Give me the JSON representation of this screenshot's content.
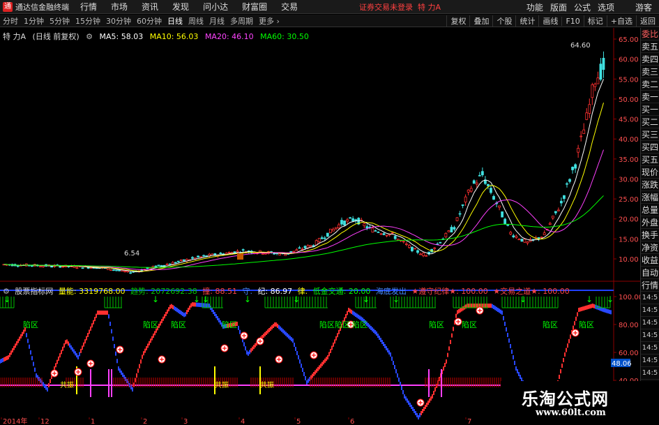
{
  "app": {
    "title": "通达信金融终端",
    "menus": [
      "行情",
      "市场",
      "资讯",
      "发现",
      "问小达",
      "财富圈",
      "交易"
    ],
    "notice": "证券交易未登录",
    "stock_name": "特 力A",
    "right_menus": [
      "功能",
      "版面",
      "公式",
      "选项"
    ],
    "guest": "游客"
  },
  "periods": {
    "items": [
      "分时",
      "1分钟",
      "5分钟",
      "15分钟",
      "30分钟",
      "60分钟",
      "日线",
      "周线",
      "月线",
      "多周期",
      "更多"
    ],
    "active_index": 6
  },
  "tools": [
    "复权",
    "叠加",
    "个股",
    "统计",
    "画线",
    "F10",
    "标记",
    "+自选",
    "返回"
  ],
  "main_legend": {
    "stock": "特 力A",
    "mode": "(日线 前复权)",
    "ma5": "MA5: 58.03",
    "ma10": "MA10: 56.03",
    "ma20": "MA20: 46.10",
    "ma60": "MA60: 30.50",
    "high_label": "64.60",
    "low_label": "6.54",
    "colors": {
      "ma5": "#ffffff",
      "ma10": "#ffff00",
      "ma20": "#ff40ff",
      "ma60": "#00ff00"
    }
  },
  "price_axis": [
    "65.00",
    "60.00",
    "55.00",
    "50.00",
    "45.00",
    "40.00",
    "35.00",
    "30.00",
    "25.00",
    "20.00",
    "15.00",
    "10.00"
  ],
  "indicator_legend": {
    "name": "股票指标网",
    "volume": "量能: 3319768.00",
    "trend": "趋势: 2072692.38",
    "p1": "撞: 88.51",
    "p2": "守.",
    "p3": "纪: 86.97",
    "p4": "律.",
    "p5": "低金交通: 20.00",
    "p6": "海底发出",
    "p7": "★遵守纪律★: 100.00",
    "p8": "★交易之道★: 100.00"
  },
  "indicator_axis": [
    "100.00",
    "80.00",
    "60.00",
    "40.00"
  ],
  "indicator_value": "48.06",
  "side_items": [
    "委比",
    "卖五",
    "卖四",
    "卖三",
    "卖二",
    "卖一",
    "买一",
    "买二",
    "买三",
    "买四",
    "买五",
    "现价",
    "涨跌",
    "涨幅",
    "总量",
    "外盘",
    "换手",
    "净资",
    "收益",
    "自动",
    "行情"
  ],
  "side_times": [
    "14:5",
    "14:5",
    "14:5",
    "14:5",
    "14:5",
    "14:5",
    "14:5",
    "14:5"
  ],
  "time_axis": [
    "2014年",
    "12",
    "1",
    "2",
    "3",
    "4",
    "5",
    "6",
    "7"
  ],
  "zone_label": "陷区",
  "band_label": "共振",
  "watermark": {
    "line1": "乐淘公式网",
    "line2": "www.60lt.com"
  }
}
